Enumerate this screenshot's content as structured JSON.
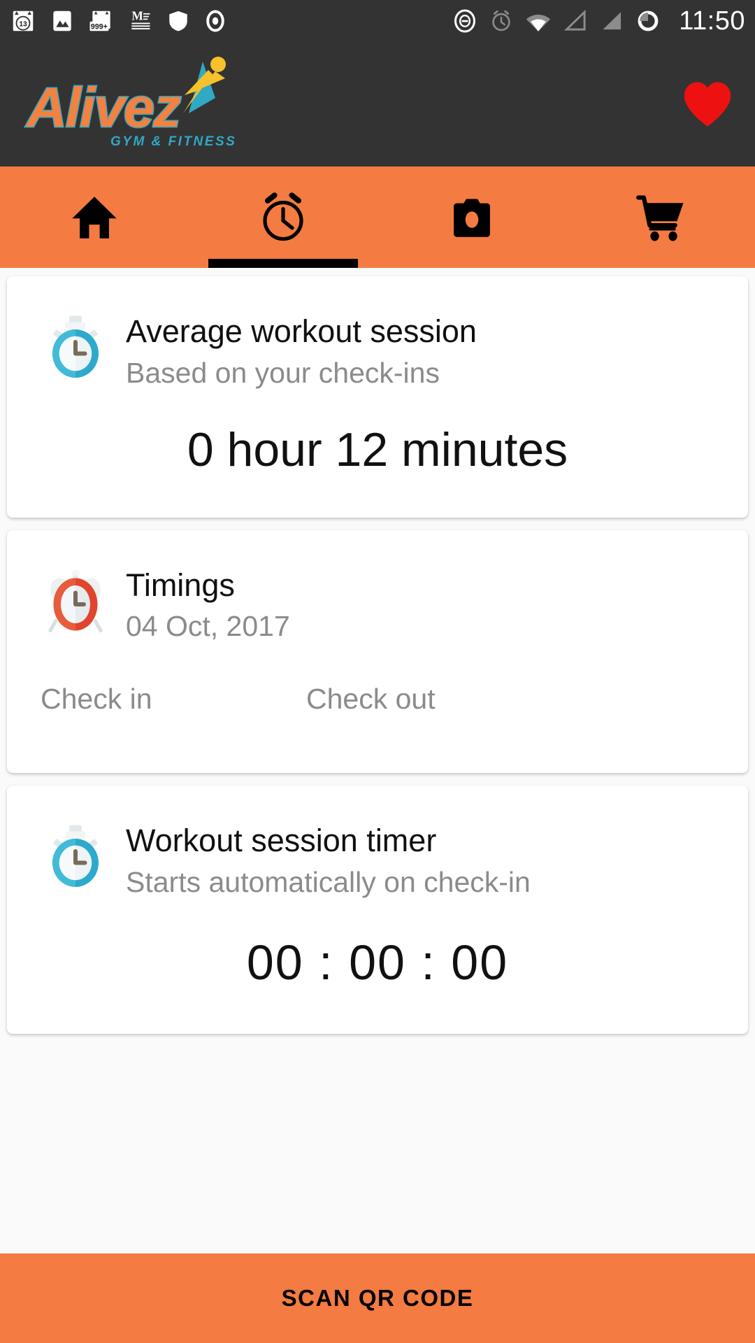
{
  "status_bar": {
    "time": "11:50",
    "left_icons": [
      {
        "name": "calendar-icon",
        "badge": "13"
      },
      {
        "name": "gallery-icon",
        "badge": ""
      },
      {
        "name": "messages-icon",
        "badge": "999+"
      },
      {
        "name": "medium-icon",
        "badge": ""
      },
      {
        "name": "shield-icon",
        "badge": ""
      },
      {
        "name": "record-icon",
        "badge": ""
      }
    ],
    "right_icons": [
      {
        "name": "do-not-disturb-icon"
      },
      {
        "name": "alarm-icon"
      },
      {
        "name": "wifi-icon"
      },
      {
        "name": "signal-sim1-icon"
      },
      {
        "name": "signal-sim2-icon"
      },
      {
        "name": "battery-icon"
      }
    ]
  },
  "app_header": {
    "logo_text": "Alivez",
    "logo_subtitle": "GYM & FITNESS",
    "favorite_icon": "heart-icon"
  },
  "tabs": [
    {
      "icon": "home-icon",
      "label": "Home",
      "active": false
    },
    {
      "icon": "alarm-clock-icon",
      "label": "Timings",
      "active": true
    },
    {
      "icon": "camera-icon",
      "label": "Camera",
      "active": false
    },
    {
      "icon": "shopping-cart-icon",
      "label": "Store",
      "active": false
    }
  ],
  "cards": {
    "average_session": {
      "icon": "stopwatch-blue-icon",
      "title": "Average workout session",
      "subtitle": "Based on your check-ins",
      "value": "0 hour 12 minutes"
    },
    "timings": {
      "icon": "alarm-clock-red-icon",
      "title": "Timings",
      "subtitle": "04 Oct, 2017",
      "check_in_label": "Check in",
      "check_in_value": "",
      "check_out_label": "Check out",
      "check_out_value": ""
    },
    "session_timer": {
      "icon": "stopwatch-blue-icon",
      "title": "Workout session timer",
      "subtitle": "Starts automatically on check-in",
      "value": "00 : 00 : 00"
    }
  },
  "bottom_action": {
    "label": "SCAN QR CODE"
  },
  "colors": {
    "accent_orange": "#F47B41",
    "header_dark": "#333333",
    "logo_orange": "#F4813F",
    "logo_cyan": "#31A8C4",
    "heart_red": "#EE1111",
    "stopwatch_blue": "#2DAACB",
    "alarm_red": "#E0452B"
  }
}
